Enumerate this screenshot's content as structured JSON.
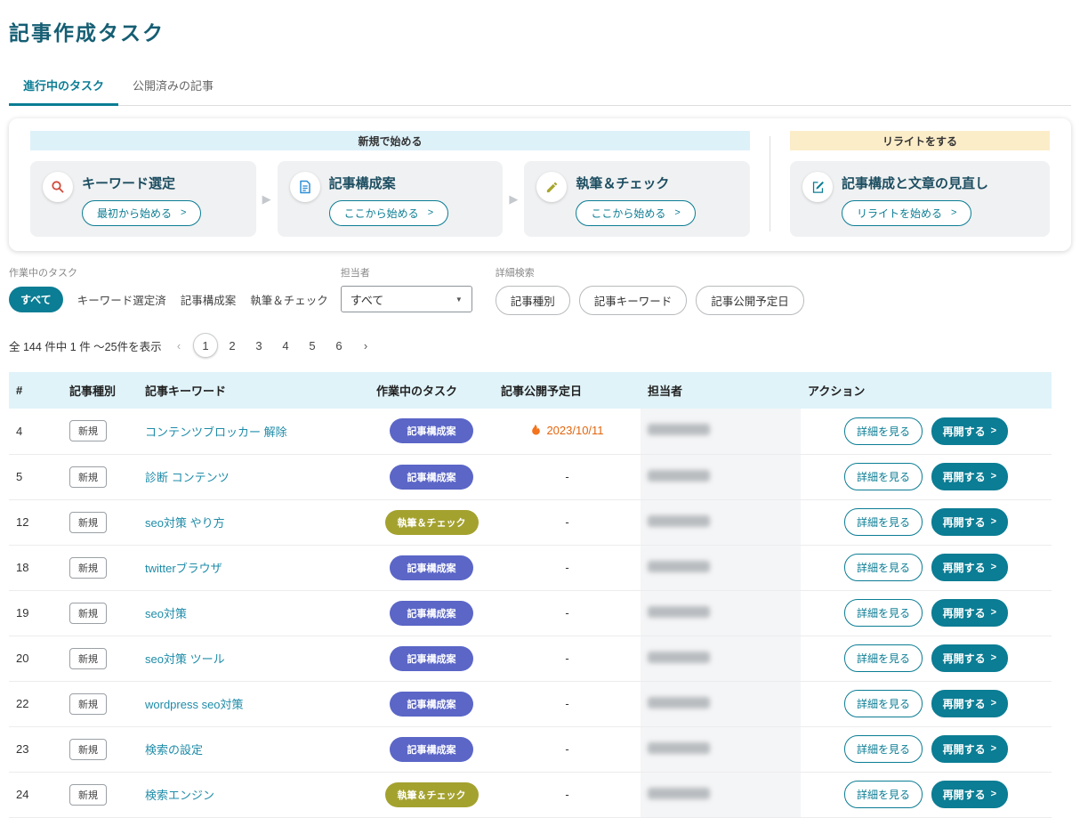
{
  "page": {
    "title": "記事作成タスク"
  },
  "tabs": [
    {
      "label": "進行中のタスク",
      "active": true
    },
    {
      "label": "公開済みの記事",
      "active": false
    }
  ],
  "workflow": {
    "new_band": "新規で始める",
    "rewrite_band": "リライトをする",
    "steps": [
      {
        "icon": "search-icon",
        "title": "キーワード選定",
        "button": "最初から始める"
      },
      {
        "icon": "document-icon",
        "title": "記事構成案",
        "button": "ここから始める"
      },
      {
        "icon": "pencil-icon",
        "title": "執筆＆チェック",
        "button": "ここから始める"
      }
    ],
    "rewrite": {
      "icon": "document-edit-icon",
      "title": "記事構成と文章の見直し",
      "button": "リライトを始める"
    }
  },
  "filters": {
    "label": "作業中のタスク",
    "chips": [
      {
        "label": "すべて",
        "active": true
      },
      {
        "label": "キーワード選定済",
        "active": false
      },
      {
        "label": "記事構成案",
        "active": false
      },
      {
        "label": "執筆＆チェック",
        "active": false
      }
    ],
    "assignee": {
      "label": "担当者",
      "value": "すべて"
    },
    "advanced": {
      "label": "詳細検索",
      "chips": [
        "記事種別",
        "記事キーワード",
        "記事公開予定日"
      ]
    }
  },
  "pagination": {
    "summary": "全 144 件中 1 件 ～25件を表示",
    "pages": [
      "1",
      "2",
      "3",
      "4",
      "5",
      "6"
    ],
    "current": "1"
  },
  "table": {
    "headers": [
      "#",
      "記事種別",
      "記事キーワード",
      "作業中のタスク",
      "記事公開予定日",
      "担当者",
      "アクション"
    ],
    "actions": {
      "detail": "詳細を見る",
      "resume": "再開する"
    },
    "rows": [
      {
        "num": "4",
        "type": "新規",
        "keyword": "コンテンツブロッカー 解除",
        "task": "記事構成案",
        "task_style": "structure",
        "date": "2023/10/11",
        "hot": true,
        "assignee_masked": true
      },
      {
        "num": "5",
        "type": "新規",
        "keyword": "診断 コンテンツ",
        "task": "記事構成案",
        "task_style": "structure",
        "date": "-",
        "hot": false,
        "assignee_masked": true
      },
      {
        "num": "12",
        "type": "新規",
        "keyword": "seo対策 やり方",
        "task": "執筆＆チェック",
        "task_style": "writing",
        "date": "-",
        "hot": false,
        "assignee_masked": true
      },
      {
        "num": "18",
        "type": "新規",
        "keyword": "twitterブラウザ",
        "task": "記事構成案",
        "task_style": "structure",
        "date": "-",
        "hot": false,
        "assignee_masked": true
      },
      {
        "num": "19",
        "type": "新規",
        "keyword": "seo対策",
        "task": "記事構成案",
        "task_style": "structure",
        "date": "-",
        "hot": false,
        "assignee_masked": true
      },
      {
        "num": "20",
        "type": "新規",
        "keyword": "seo対策 ツール",
        "task": "記事構成案",
        "task_style": "structure",
        "date": "-",
        "hot": false,
        "assignee_masked": true
      },
      {
        "num": "22",
        "type": "新規",
        "keyword": "wordpress seo対策",
        "task": "記事構成案",
        "task_style": "structure",
        "date": "-",
        "hot": false,
        "assignee_masked": true
      },
      {
        "num": "23",
        "type": "新規",
        "keyword": "検索の設定",
        "task": "記事構成案",
        "task_style": "structure",
        "date": "-",
        "hot": false,
        "assignee_masked": true
      },
      {
        "num": "24",
        "type": "新規",
        "keyword": "検索エンジン",
        "task": "執筆＆チェック",
        "task_style": "writing",
        "date": "-",
        "hot": false,
        "assignee_masked": true
      }
    ]
  },
  "theme": {
    "primary": "#0b7d94",
    "title_color": "#155e73",
    "badge_structure": "#5b66c7",
    "badge_writing": "#a4a22f",
    "hot_date": "#e2660f",
    "band_blue": "#ddf1f9",
    "band_orange": "#fcedc9",
    "header_bg": "#e0f3f9",
    "link_color": "#1e8ca8"
  }
}
